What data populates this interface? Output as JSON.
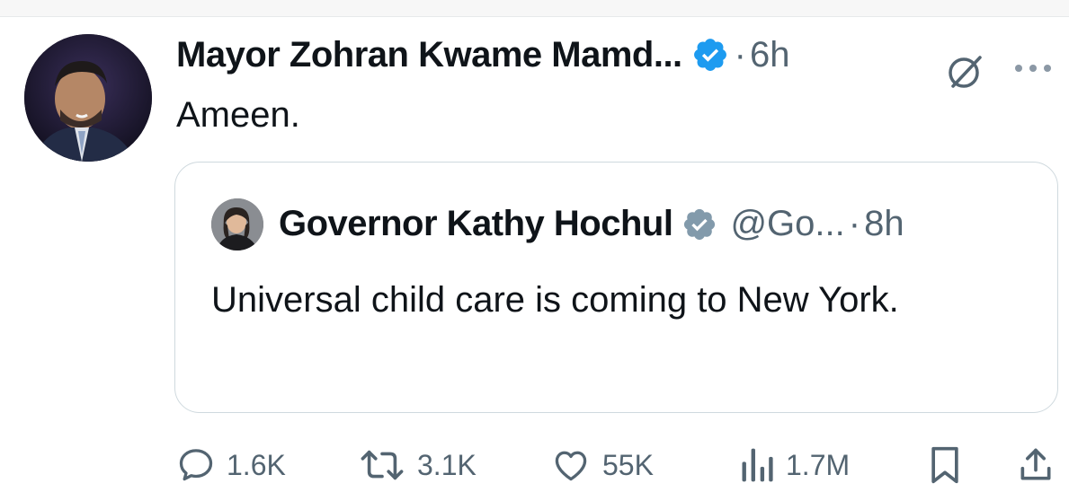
{
  "tweet": {
    "author_name": "Mayor Zohran Kwame Mamd...",
    "separator": "·",
    "time": "6h",
    "text": "Ameen.",
    "verified_color": "#1d9bf0",
    "avatar_icon": "user-photo",
    "grok_icon": "grok-icon",
    "more_icon": "more-options-icon"
  },
  "quote": {
    "author_name": "Governor Kathy Hochul",
    "handle": "@Go...",
    "separator": "·",
    "time": "8h",
    "text": "Universal child care is coming to New York.",
    "verified_color": "#829aab",
    "avatar_icon": "user-photo"
  },
  "actions": {
    "replies": {
      "count": "1.6K",
      "icon": "reply-icon"
    },
    "reposts": {
      "count": "3.1K",
      "icon": "repost-icon"
    },
    "likes": {
      "count": "55K",
      "icon": "heart-icon"
    },
    "views": {
      "count": "1.7M",
      "icon": "views-icon"
    },
    "bookmark": {
      "icon": "bookmark-icon"
    },
    "share": {
      "icon": "share-icon"
    }
  },
  "colors": {
    "text_primary": "#0f1419",
    "text_secondary": "#536471",
    "border": "#cfd9de",
    "accent_blue": "#1d9bf0"
  }
}
